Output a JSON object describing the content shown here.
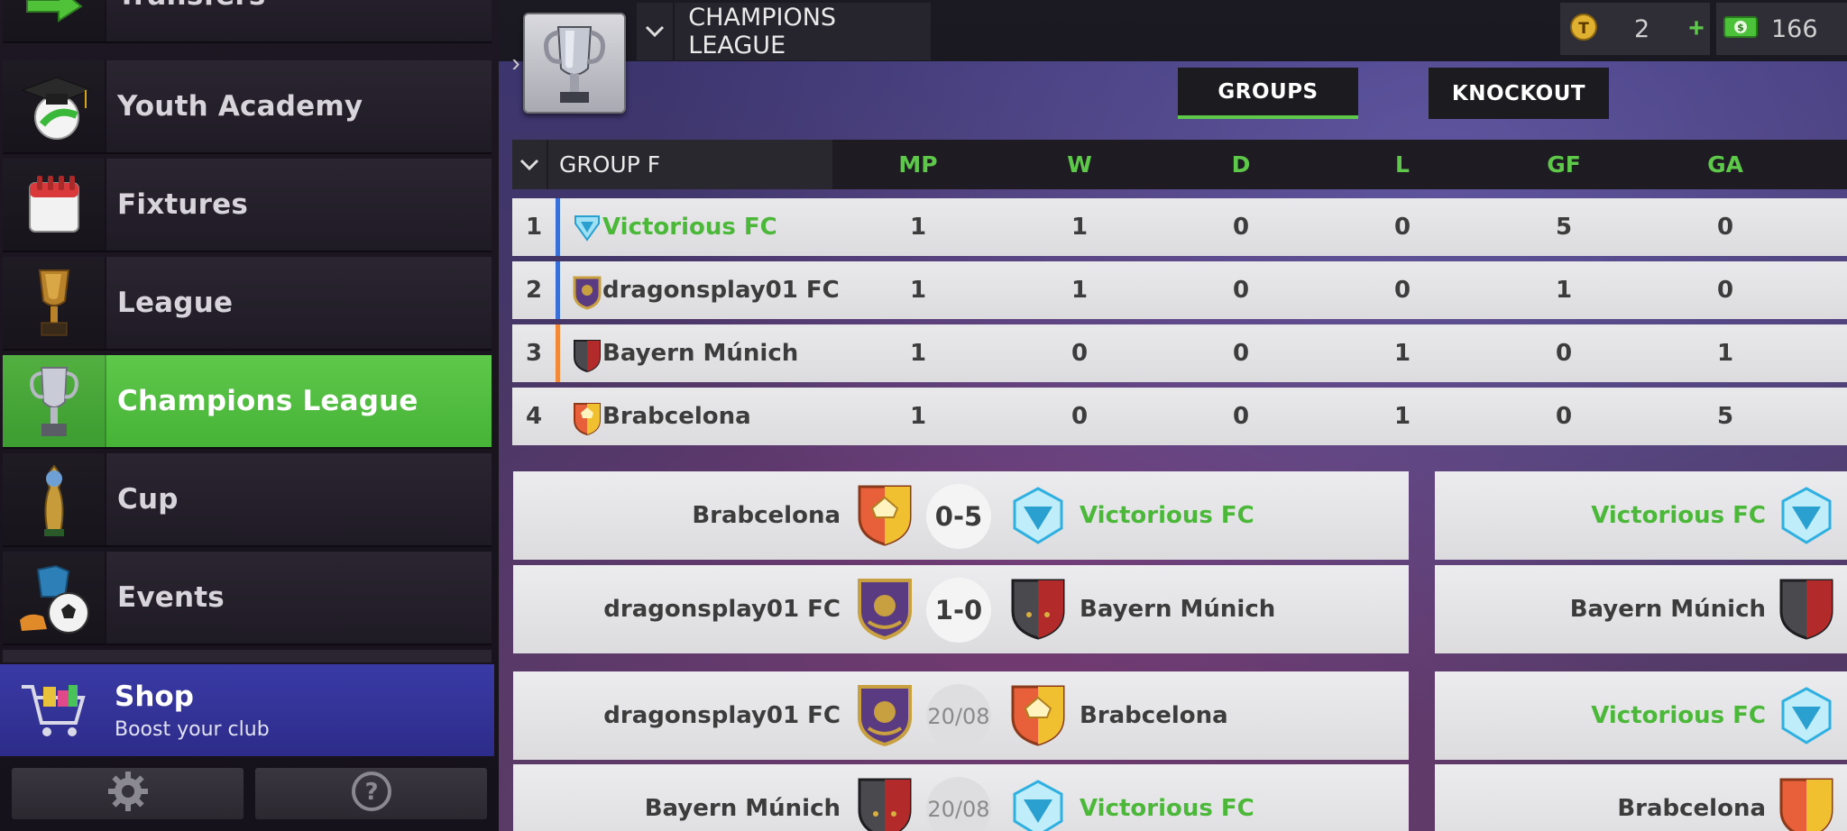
{
  "sidebar": {
    "items": [
      {
        "label": "Transfers",
        "icon": "transfers-arrow-icon"
      },
      {
        "label": "Youth Academy",
        "icon": "graduation-cap-ball-icon"
      },
      {
        "label": "Fixtures",
        "icon": "calendar-icon"
      },
      {
        "label": "League",
        "icon": "league-trophy-icon"
      },
      {
        "label": "Champions League",
        "icon": "champions-trophy-icon"
      },
      {
        "label": "Cup",
        "icon": "cup-trophy-icon"
      },
      {
        "label": "Events",
        "icon": "events-player-icon"
      }
    ],
    "active_index": 4,
    "shop": {
      "title": "Shop",
      "subtitle": "Boost your club",
      "icon": "shopping-cart-icon"
    },
    "bottom": {
      "settings_icon": "gear-icon",
      "help_icon": "help-icon"
    }
  },
  "header": {
    "competition": "CHAMPIONS LEAGUE",
    "tokens": "2",
    "cash": "166",
    "plus": "+"
  },
  "tabs": [
    {
      "label": "GROUPS",
      "active": true
    },
    {
      "label": "KNOCKOUT",
      "active": false
    }
  ],
  "standings": {
    "group": "GROUP F",
    "columns": [
      "MP",
      "W",
      "D",
      "L",
      "GF",
      "GA"
    ],
    "rows": [
      {
        "pos": "1",
        "team": "Victorious FC",
        "highlight": true,
        "bar": "#3a6fd6",
        "mp": "1",
        "w": "1",
        "d": "0",
        "l": "0",
        "gf": "5",
        "ga": "0"
      },
      {
        "pos": "2",
        "team": "dragonsplay01 FC",
        "highlight": false,
        "bar": "#3a6fd6",
        "mp": "1",
        "w": "1",
        "d": "0",
        "l": "0",
        "gf": "1",
        "ga": "0"
      },
      {
        "pos": "3",
        "team": "Bayern Múnich",
        "highlight": false,
        "bar": "#f08a3a",
        "mp": "1",
        "w": "0",
        "d": "0",
        "l": "1",
        "gf": "0",
        "ga": "1"
      },
      {
        "pos": "4",
        "team": "Brabcelona",
        "highlight": false,
        "bar": "transparent",
        "mp": "1",
        "w": "0",
        "d": "0",
        "l": "1",
        "gf": "0",
        "ga": "5"
      }
    ]
  },
  "matches": [
    {
      "home": "Brabcelona",
      "score": "0-5",
      "away": "Victorious FC",
      "played": true
    },
    {
      "home": "dragonsplay01 FC",
      "score": "1-0",
      "away": "Bayern Múnich",
      "played": true
    },
    {
      "home": "dragonsplay01 FC",
      "score": "20/08",
      "away": "Brabcelona",
      "played": false
    },
    {
      "home": "Bayern Múnich",
      "score": "20/08",
      "away": "Victorious FC",
      "played": false
    }
  ],
  "matches_right": [
    {
      "home": "Victorious FC"
    },
    {
      "home": "Bayern Múnich"
    },
    {
      "home": "Victorious FC"
    },
    {
      "home": "Brabcelona"
    }
  ],
  "colors": {
    "accent_green": "#5ec84a",
    "team_green": "#4cb83a"
  }
}
